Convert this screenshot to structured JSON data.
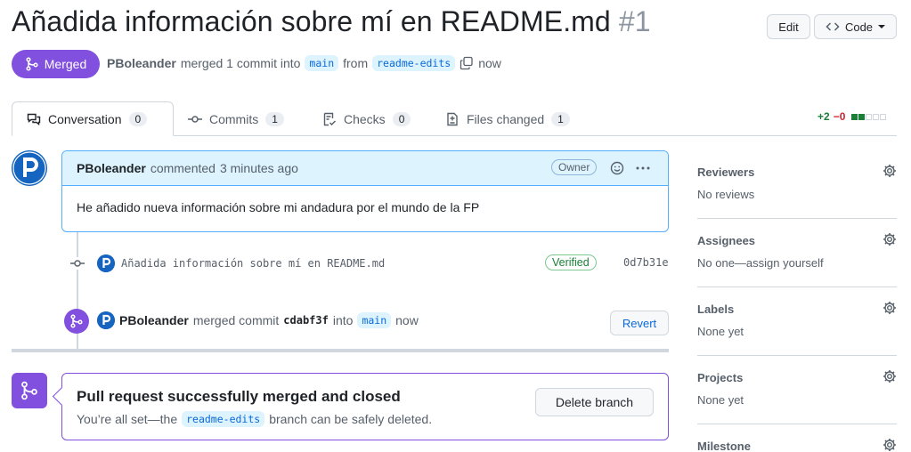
{
  "header": {
    "title": "Añadida información sobre mí en README.md",
    "number": "#1",
    "edit_label": "Edit",
    "code_label": "Code"
  },
  "status": {
    "badge": "Merged",
    "author": "PBoleander",
    "merged_text": "merged 1 commit into",
    "base_branch": "main",
    "from_text": "from",
    "head_branch": "readme-edits",
    "time": "now"
  },
  "tabs": [
    {
      "label": "Conversation",
      "count": "0",
      "icon": "comment-discussion-icon"
    },
    {
      "label": "Commits",
      "count": "1",
      "icon": "git-commit-icon"
    },
    {
      "label": "Checks",
      "count": "0",
      "icon": "checklist-icon"
    },
    {
      "label": "Files changed",
      "count": "1",
      "icon": "file-diff-icon"
    }
  ],
  "diffstat": {
    "additions": "+2",
    "deletions": "−0"
  },
  "comment": {
    "author": "PBoleander",
    "action": "commented",
    "time": "3 minutes ago",
    "role": "Owner",
    "body": "He añadido nueva información sobre mi andadura por el mundo de la FP"
  },
  "commit": {
    "message": "Añadida información sobre mí en README.md",
    "verified": "Verified",
    "sha": "0d7b31e"
  },
  "merge_event": {
    "author": "PBoleander",
    "action": "merged commit",
    "sha": "cdabf3f",
    "into": "into",
    "branch": "main",
    "time": "now",
    "revert_label": "Revert"
  },
  "merge_box": {
    "title": "Pull request successfully merged and closed",
    "sub_prefix": "You’re all set—the",
    "branch": "readme-edits",
    "sub_suffix": "branch can be safely deleted.",
    "delete_label": "Delete branch"
  },
  "sidebar": [
    {
      "title": "Reviewers",
      "value": "No reviews"
    },
    {
      "title": "Assignees",
      "value": "No one—assign yourself"
    },
    {
      "title": "Labels",
      "value": "None yet"
    },
    {
      "title": "Projects",
      "value": "None yet"
    },
    {
      "title": "Milestone",
      "value": ""
    }
  ],
  "colors": {
    "merged_purple": "#8250df",
    "link_blue": "#0969da",
    "add_green": "#1a7f37",
    "del_red": "#cf222e"
  }
}
